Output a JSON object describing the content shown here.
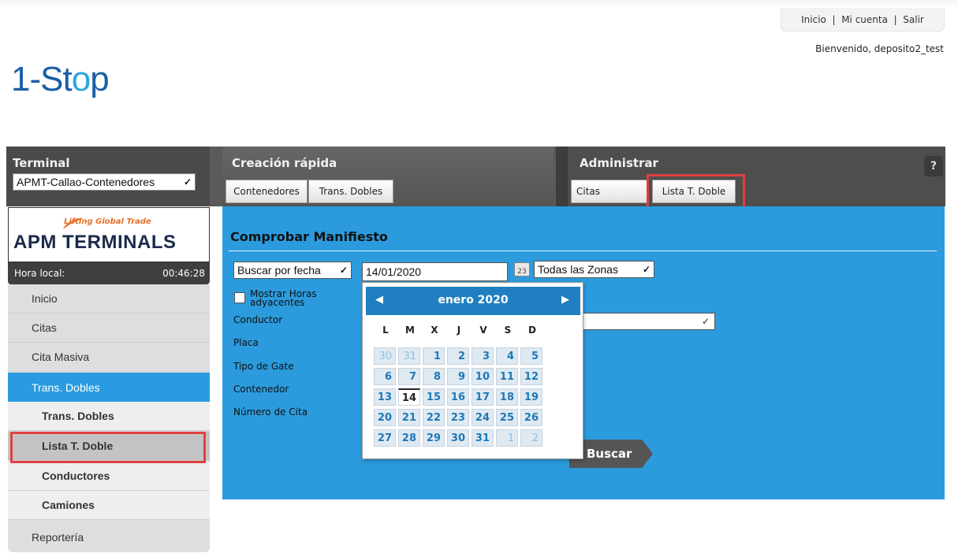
{
  "header": {
    "links": [
      {
        "label": "Inicio"
      },
      {
        "label": "Mi cuenta"
      },
      {
        "label": "Salir"
      }
    ],
    "welcome": "Bienvenido, deposito2_test",
    "logo_text_a": "1-St",
    "logo_text_b": "o",
    "logo_text_c": "p"
  },
  "nav": {
    "terminal_title": "Terminal",
    "terminal_value": "APMT-Callao-Contenedores",
    "rapida_title": "Creación rápida",
    "rapida_tabs": [
      "Contenedores",
      "Trans. Dobles"
    ],
    "admin_title": "Administrar",
    "admin_tabs": [
      "Citas",
      "Lista T. Doble"
    ]
  },
  "sidebar": {
    "brand_tagline": "Lifting Global Trade",
    "brand_name": "APM TERMINALS",
    "clock_label": "Hora local:",
    "clock_value": "00:46:28",
    "items": [
      {
        "label": "Inicio"
      },
      {
        "label": "Citas"
      },
      {
        "label": "Cita Masiva"
      },
      {
        "label": "Trans. Dobles"
      },
      {
        "label": "Trans. Dobles"
      },
      {
        "label": "Lista T. Doble"
      },
      {
        "label": "Conductores"
      },
      {
        "label": "Camiones"
      },
      {
        "label": "Reportería"
      }
    ]
  },
  "main": {
    "title": "Comprobar Manifiesto",
    "search_mode": "Buscar por fecha",
    "date_value": "14/01/2020",
    "calendar_icon_text": "23",
    "zone_select": "Todas las Zonas",
    "checkbox_label": "Mostrar Horas adyacentes",
    "fields": [
      "Conductor",
      "Placa",
      "Tipo de Gate",
      "Contenedor",
      "Número de Cita"
    ],
    "search_button": "Buscar"
  },
  "calendar": {
    "month_label": "enero 2020",
    "weekdays": [
      "L",
      "M",
      "X",
      "J",
      "V",
      "S",
      "D"
    ],
    "weeks": [
      [
        "30",
        "31",
        "1",
        "2",
        "3",
        "4",
        "5"
      ],
      [
        "6",
        "7",
        "8",
        "9",
        "10",
        "11",
        "12"
      ],
      [
        "13",
        "14",
        "15",
        "16",
        "17",
        "18",
        "19"
      ],
      [
        "20",
        "21",
        "22",
        "23",
        "24",
        "25",
        "26"
      ],
      [
        "27",
        "28",
        "29",
        "30",
        "31",
        "1",
        "2"
      ]
    ],
    "selected_day": "14"
  },
  "colors": {
    "accent_blue": "#2b9bdd",
    "highlight_red": "#e04040",
    "nav_dark": "#4a4a4a"
  }
}
